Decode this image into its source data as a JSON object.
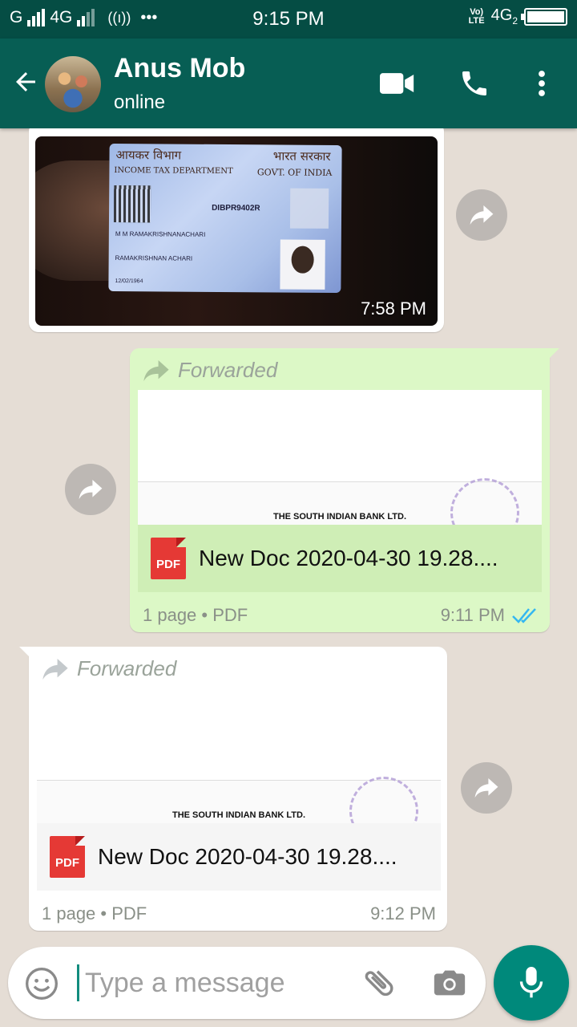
{
  "status_bar": {
    "network_left": "G",
    "network_type": "4G",
    "time": "9:15 PM",
    "volte_top": "Vo)",
    "volte_bottom": "LTE",
    "network_right": "4G",
    "sim_index": "2",
    "battery_icon": "battery-icon"
  },
  "header": {
    "contact_name": "Anus Mob",
    "contact_status": "online",
    "icons": [
      "back-arrow-icon",
      "video-call-icon",
      "phone-icon",
      "more-vert-icon"
    ]
  },
  "messages": [
    {
      "type": "image",
      "direction": "incoming",
      "time": "7:58 PM",
      "card": {
        "hindi_left": "आयकर विभाग",
        "hindi_right": "भारत सरकार",
        "dept": "INCOME TAX DEPARTMENT",
        "govt": "GOVT. OF INDIA",
        "number": "DIBPR9402R",
        "name": "M M RAMAKRISHNANACHARI",
        "father": "RAMAKRISHNAN ACHARI",
        "dob": "12/02/1964"
      }
    },
    {
      "type": "document",
      "direction": "outgoing",
      "forwarded_label": "Forwarded",
      "preview_text": "THE SOUTH INDIAN BANK LTD.",
      "file_type_badge": "PDF",
      "file_name": "New Doc 2020-04-30 19.28....",
      "meta": "1 page • PDF",
      "time": "9:11 PM",
      "status": "read"
    },
    {
      "type": "document",
      "direction": "incoming",
      "forwarded_label": "Forwarded",
      "preview_text": "THE SOUTH INDIAN BANK LTD.",
      "file_type_badge": "PDF",
      "file_name": "New Doc 2020-04-30 19.28....",
      "meta": "1 page • PDF",
      "time": "9:12 PM"
    }
  ],
  "composer": {
    "placeholder": "Type a message",
    "icons": [
      "emoji-icon",
      "attach-icon",
      "camera-icon",
      "mic-icon"
    ]
  },
  "colors": {
    "header": "#075e54",
    "status_bar": "#054d44",
    "outgoing_bubble": "#dcf8c6",
    "incoming_bubble": "#ffffff",
    "mic_button": "#00897b",
    "read_ticks": "#34b7f1"
  }
}
